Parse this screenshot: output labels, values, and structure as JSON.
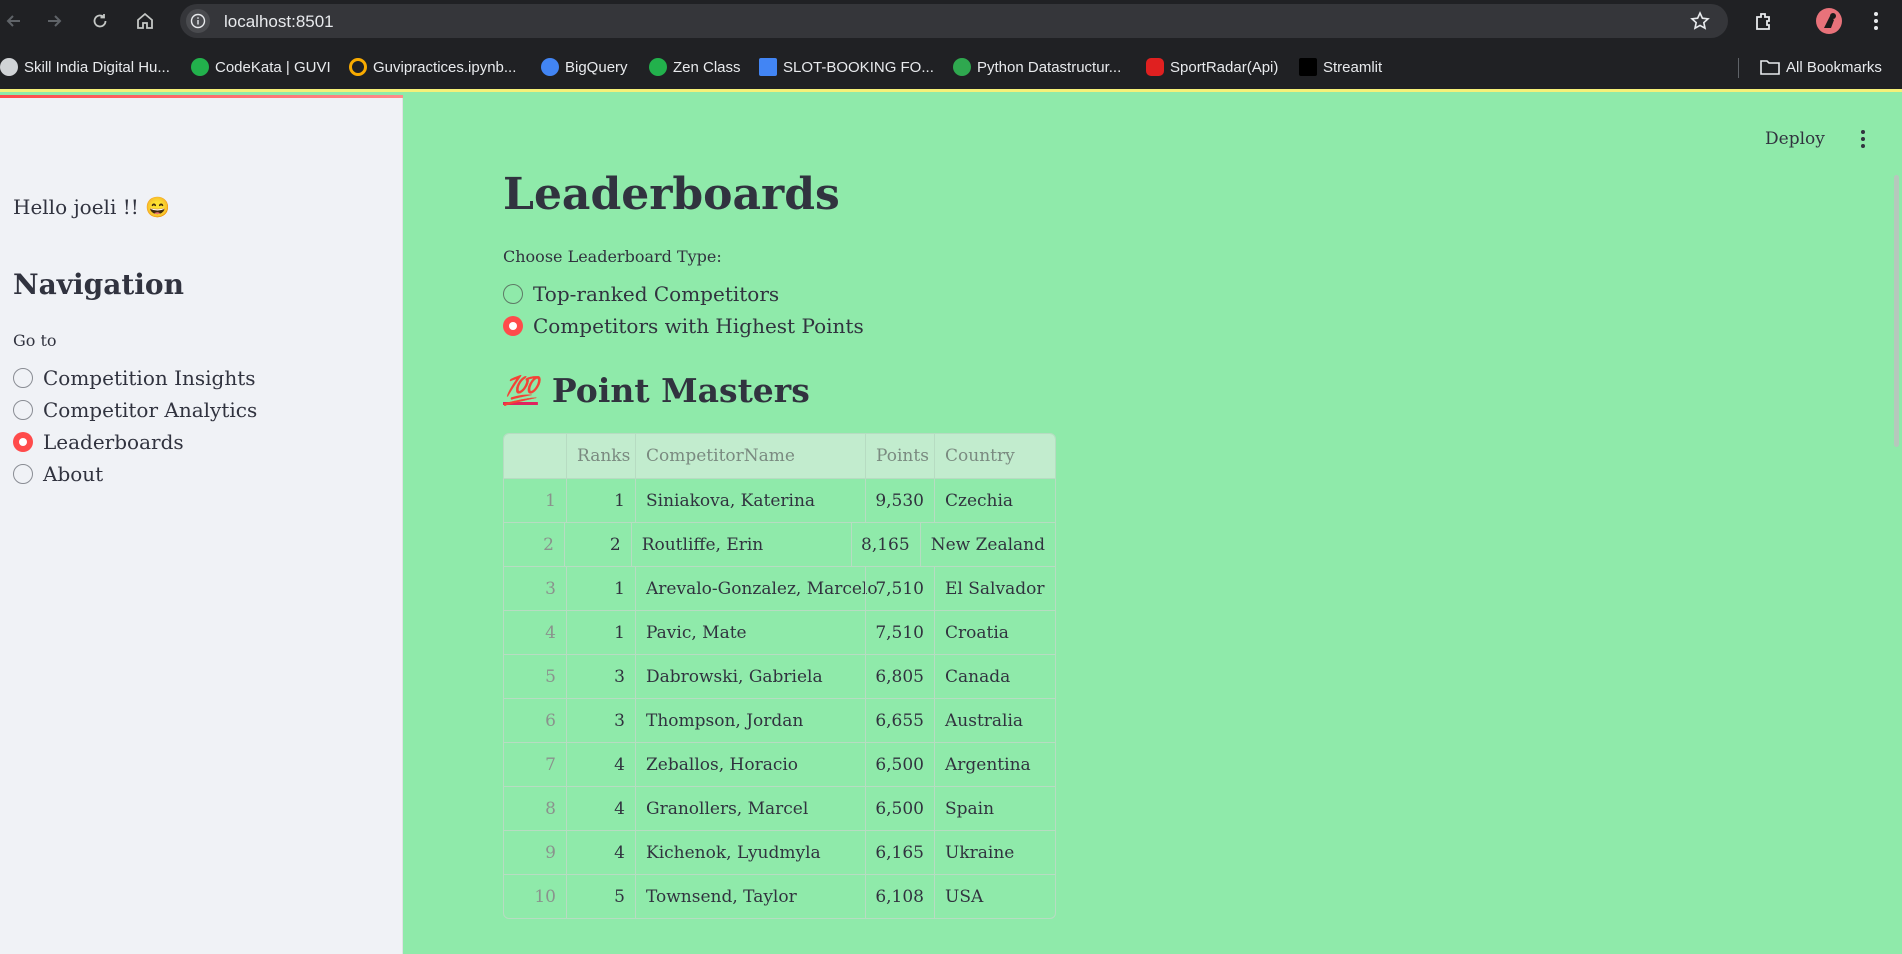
{
  "browser": {
    "url": "localhost:8501",
    "bookmarks": [
      {
        "label": "Skill India Digital Hu...",
        "icon": "skill-india-icon",
        "color": "#9aa0a6"
      },
      {
        "label": "CodeKata | GUVI",
        "icon": "guvi-icon",
        "color": "#22b14c"
      },
      {
        "label": "Guvipractices.ipynb...",
        "icon": "colab-icon",
        "color": "#f9ab00"
      },
      {
        "label": "BigQuery",
        "icon": "bigquery-icon",
        "color": "#4285f4"
      },
      {
        "label": "Zen Class",
        "icon": "guvi-icon",
        "color": "#22b14c"
      },
      {
        "label": "SLOT-BOOKING FO...",
        "icon": "google-docs-icon",
        "color": "#4285f4"
      },
      {
        "label": "Python Datastructur...",
        "icon": "python-leaf-icon",
        "color": "#2fa84f"
      },
      {
        "label": "SportRadar(Api)",
        "icon": "youtube-icon",
        "color": "#e02020"
      },
      {
        "label": "Streamlit",
        "icon": "medium-icon",
        "color": "#000000"
      }
    ],
    "all_bookmarks": "All Bookmarks"
  },
  "sidebar": {
    "greeting": "Hello joeli !! 😄",
    "nav_title": "Navigation",
    "goto_label": "Go to",
    "items": [
      {
        "label": "Competition Insights",
        "selected": false
      },
      {
        "label": "Competitor Analytics",
        "selected": false
      },
      {
        "label": "Leaderboards",
        "selected": true
      },
      {
        "label": "About",
        "selected": false
      }
    ]
  },
  "main": {
    "deploy_label": "Deploy",
    "title": "Leaderboards",
    "choose_label": "Choose Leaderboard Type:",
    "options": [
      {
        "label": "Top-ranked Competitors",
        "selected": false
      },
      {
        "label": "Competitors with Highest Points",
        "selected": true
      }
    ],
    "section_emoji": "💯",
    "section_title": "Point Masters"
  },
  "table": {
    "columns": [
      "",
      "Ranks",
      "CompetitorName",
      "Points",
      "Country"
    ],
    "rows": [
      [
        "1",
        "1",
        "Siniakova, Katerina",
        "9,530",
        "Czechia"
      ],
      [
        "2",
        "2",
        "Routliffe, Erin",
        "8,165",
        "New Zealand"
      ],
      [
        "3",
        "1",
        "Arevalo-Gonzalez, Marcelo",
        "7,510",
        "El Salvador"
      ],
      [
        "4",
        "1",
        "Pavic, Mate",
        "7,510",
        "Croatia"
      ],
      [
        "5",
        "3",
        "Dabrowski, Gabriela",
        "6,805",
        "Canada"
      ],
      [
        "6",
        "3",
        "Thompson, Jordan",
        "6,655",
        "Australia"
      ],
      [
        "7",
        "4",
        "Zeballos, Horacio",
        "6,500",
        "Argentina"
      ],
      [
        "8",
        "4",
        "Granollers, Marcel",
        "6,500",
        "Spain"
      ],
      [
        "9",
        "4",
        "Kichenok, Lyudmyla",
        "6,165",
        "Ukraine"
      ],
      [
        "10",
        "5",
        "Townsend, Taylor",
        "6,108",
        "USA"
      ]
    ]
  },
  "colors": {
    "app_background": "#8feaaa",
    "sidebar_background": "#f0f2f6",
    "accent": "#ff4b4b",
    "text": "#31333f"
  }
}
